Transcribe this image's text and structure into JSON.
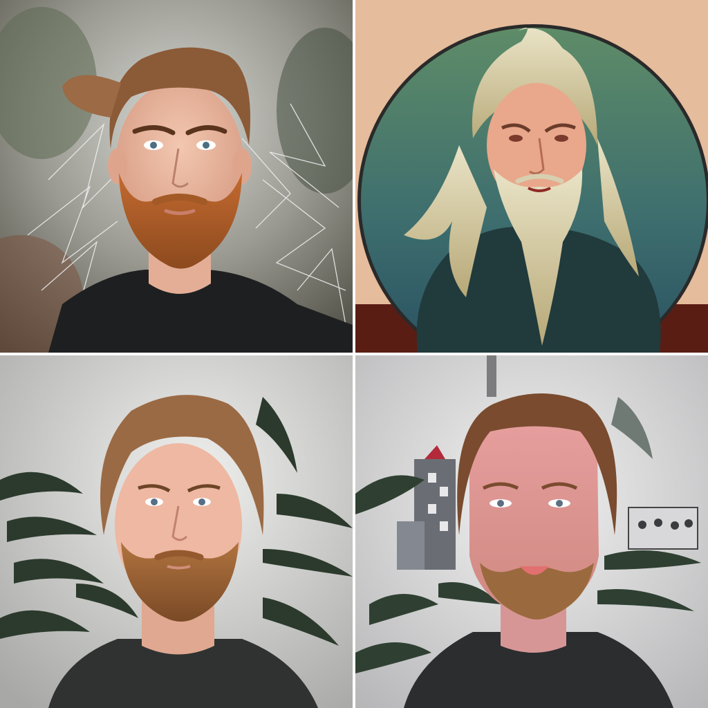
{
  "grid": {
    "panels": [
      {
        "subject": "photo-portrait-bearded-man-ginger",
        "background_color": "#8e8e86"
      },
      {
        "subject": "illustrated-portrait-white-bearded-man",
        "background_color": "#e5bc9c",
        "disc_color": "#4e7b6a"
      },
      {
        "subject": "photo-portrait-bearded-man-plants",
        "background_color": "#d4d4d2"
      },
      {
        "subject": "painted-portrait-bearded-man-plants",
        "background_color": "#dcdcdc"
      }
    ]
  }
}
